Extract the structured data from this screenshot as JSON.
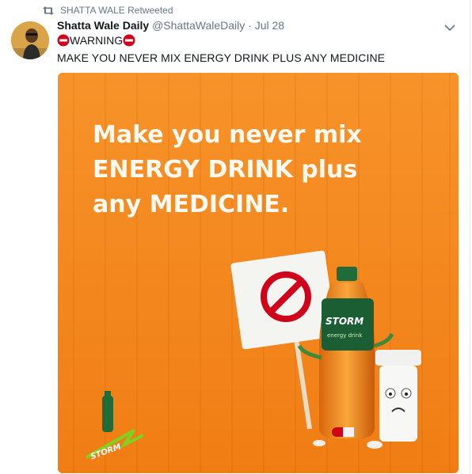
{
  "retweet": {
    "label": "SHATTA WALE Retweeted",
    "icon": "retweet-icon"
  },
  "tweet": {
    "author_name": "Shatta Wale Daily",
    "handle": "@ShattaWaleDaily",
    "separator": "·",
    "date": "Jul 28",
    "warning_text": "WARNING",
    "body_text": "MAKE YOU NEVER MIX ENERGY DRINK PLUS ANY MEDICINE"
  },
  "media": {
    "poster_lines": [
      "Make you never mix",
      "ENERGY DRINK plus",
      "any MEDICINE."
    ],
    "brand_bottle": "STORM",
    "bottle_brand": "STORM",
    "bottle_subtitle": "energy drink"
  },
  "colors": {
    "accent": "#657786",
    "poster_orange": "#f58a1f",
    "warning_red": "#d0021b",
    "bottle_green": "#1f6b3a"
  }
}
